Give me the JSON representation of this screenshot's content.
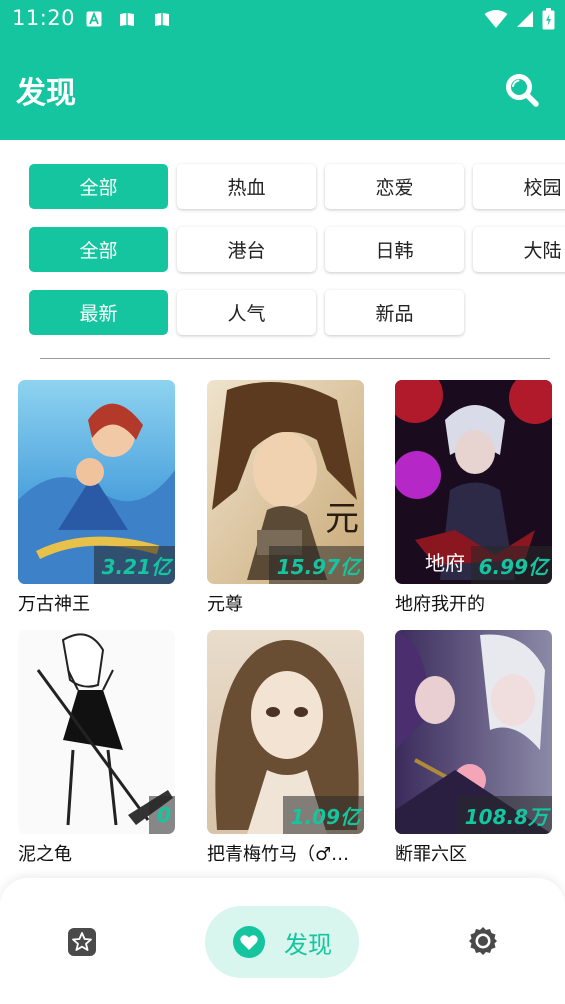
{
  "status_bar": {
    "time": "11:20"
  },
  "app_bar": {
    "title": "发现",
    "search_icon": "search-icon"
  },
  "filters": {
    "genres": [
      "全部",
      "热血",
      "恋爱",
      "校园"
    ],
    "regions": [
      "全部",
      "港台",
      "日韩",
      "大陆"
    ],
    "sorts": [
      "最新",
      "人气",
      "新品"
    ]
  },
  "comics": [
    {
      "title": "万古神王",
      "count": "3.21亿"
    },
    {
      "title": "元尊",
      "count": "15.97亿"
    },
    {
      "title": "地府我开的",
      "count": "6.99亿"
    },
    {
      "title": "泥之龟",
      "count": "0"
    },
    {
      "title": "把青梅竹马（♂…",
      "count": "1.09亿"
    },
    {
      "title": "断罪六区",
      "count": "108.8万"
    }
  ],
  "bottom_nav": {
    "favorites_icon": "star-icon",
    "discover_label": "发现",
    "discover_icon": "heart-icon",
    "settings_icon": "gear-icon"
  },
  "colors": {
    "accent": "#14c5a0",
    "accent_light": "#d8f5ee"
  }
}
